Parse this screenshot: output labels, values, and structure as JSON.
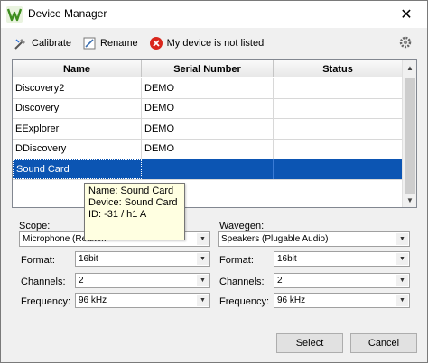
{
  "window": {
    "title": "Device Manager",
    "close_glyph": "✕"
  },
  "toolbar": {
    "calibrate_label": "Calibrate",
    "rename_label": "Rename",
    "not_listed_label": "My device is not listed"
  },
  "table": {
    "headers": {
      "name": "Name",
      "serial": "Serial Number",
      "status": "Status"
    },
    "rows": [
      {
        "name": "Discovery2",
        "serial": "DEMO",
        "status": ""
      },
      {
        "name": "Discovery",
        "serial": "DEMO",
        "status": ""
      },
      {
        "name": "EExplorer",
        "serial": "DEMO",
        "status": ""
      },
      {
        "name": "DDiscovery",
        "serial": "DEMO",
        "status": ""
      },
      {
        "name": "Sound Card",
        "serial": "",
        "status": ""
      }
    ],
    "selected_index": 4
  },
  "tooltip": {
    "line1": "Name: Sound Card",
    "line2": "Device: Sound Card",
    "line3": "ID: -31 / h1 A"
  },
  "scope": {
    "label": "Scope:",
    "device": "Microphone (Realtek",
    "format_label": "Format:",
    "format": "16bit",
    "channels_label": "Channels:",
    "channels": "2",
    "frequency_label": "Frequency:",
    "frequency": "96 kHz"
  },
  "wavegen": {
    "label": "Wavegen:",
    "device": "Speakers (Plugable Audio)",
    "format_label": "Format:",
    "format": "16bit",
    "channels_label": "Channels:",
    "channels": "2",
    "frequency_label": "Frequency:",
    "frequency": "96 kHz"
  },
  "buttons": {
    "select": "Select",
    "cancel": "Cancel"
  },
  "colors": {
    "selection": "#0c55b3",
    "tooltip_bg": "#ffffe1",
    "logo_green": "#3e8e1f"
  }
}
